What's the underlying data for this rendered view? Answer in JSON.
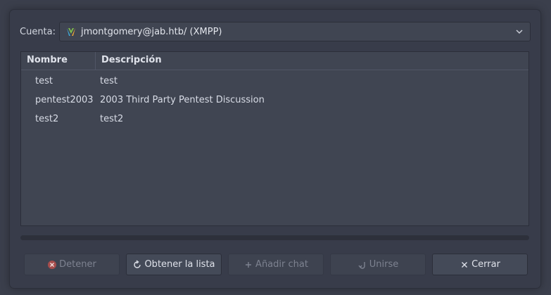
{
  "account": {
    "label": "Cuenta:",
    "selected": "jmontgomery@jab.htb/ (XMPP)",
    "icon": "xmpp-icon"
  },
  "list": {
    "columns": [
      "Nombre",
      "Descripción"
    ],
    "rows": [
      {
        "name": "test",
        "description": "test"
      },
      {
        "name": "pentest2003",
        "description": "2003 Third Party Pentest Discussion"
      },
      {
        "name": "test2",
        "description": "test2"
      }
    ]
  },
  "buttons": {
    "stop": "Detener",
    "get_list": "Obtener la lista",
    "add_chat": "Añadir chat",
    "join": "Unirse",
    "close": "Cerrar"
  },
  "colors": {
    "background": "#383c4a",
    "stop_icon": "#d9534f"
  }
}
